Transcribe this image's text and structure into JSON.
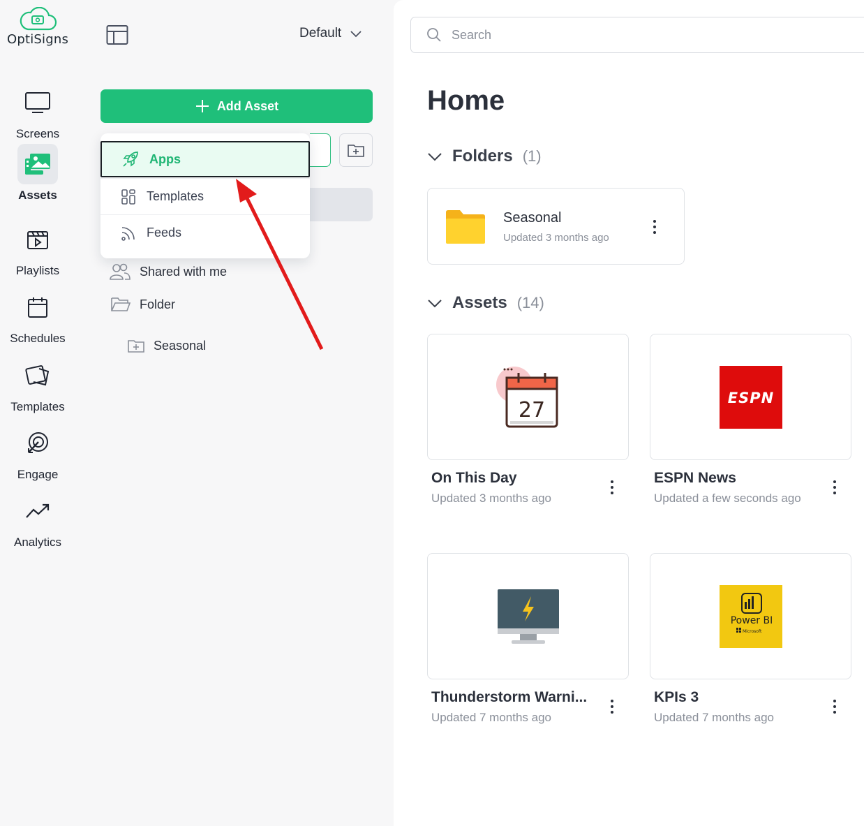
{
  "brand": {
    "name": "OptiSigns",
    "accent": "#1fbf7a"
  },
  "nav": {
    "items": [
      {
        "label": "Screens",
        "icon": "monitor-icon"
      },
      {
        "label": "Assets",
        "icon": "assets-image-icon",
        "active": true
      },
      {
        "label": "Playlists",
        "icon": "playlist-icon"
      },
      {
        "label": "Schedules",
        "icon": "calendar-icon"
      },
      {
        "label": "Templates",
        "icon": "templates-icon"
      },
      {
        "label": "Engage",
        "icon": "engage-icon"
      },
      {
        "label": "Analytics",
        "icon": "analytics-trend-icon"
      }
    ]
  },
  "panel": {
    "workspace": "Default",
    "add_asset_label": "Add Asset",
    "tree": {
      "shared": "Shared with me",
      "folder": "Folder",
      "subfolder": "Seasonal"
    }
  },
  "dropdown": {
    "items": [
      {
        "label": "Apps",
        "icon": "rocket-icon",
        "selected": true
      },
      {
        "label": "Templates",
        "icon": "grid-icon"
      },
      {
        "label": "Feeds",
        "icon": "rss-icon"
      }
    ]
  },
  "main": {
    "search_placeholder": "Search",
    "title": "Home",
    "folders": {
      "label": "Folders",
      "count": "(1)",
      "items": [
        {
          "name": "Seasonal",
          "updated": "Updated 3 months ago"
        }
      ]
    },
    "assets": {
      "label": "Assets",
      "count": "(14)",
      "items": [
        {
          "name": "On This Day",
          "updated": "Updated 3 months ago",
          "icon": "calendar-27-icon",
          "date_number": "27"
        },
        {
          "name": "ESPN News",
          "updated": "Updated a few seconds ago",
          "icon": "espn-logo-icon",
          "logo_text": "ESPN"
        },
        {
          "name": "Thunderstorm Warni...",
          "updated": "Updated 7 months ago",
          "icon": "monitor-lightning-icon"
        },
        {
          "name": "KPIs 3",
          "updated": "Updated 7 months ago",
          "icon": "powerbi-logo-icon",
          "logo_text": "Power BI",
          "logo_sub": "Microsoft"
        }
      ]
    }
  }
}
